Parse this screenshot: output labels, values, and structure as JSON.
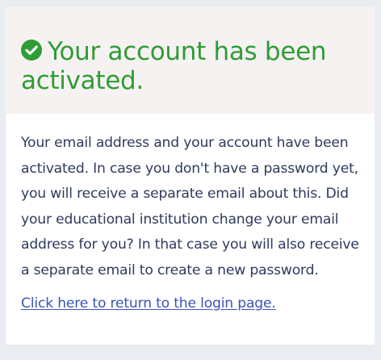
{
  "header": {
    "title": "Your account has been activated.",
    "icon": "check-circle-icon",
    "title_color": "#2e9d35"
  },
  "body": {
    "message": "Your email address and your account have been activated. In case you don't have a password yet, you will receive a separate email about this. Did your educational institution change your email address for you? In that case you will also receive a separate email to create a new password.",
    "link_text": "Click here to return to the login page.",
    "link_color": "#3a54b6"
  }
}
